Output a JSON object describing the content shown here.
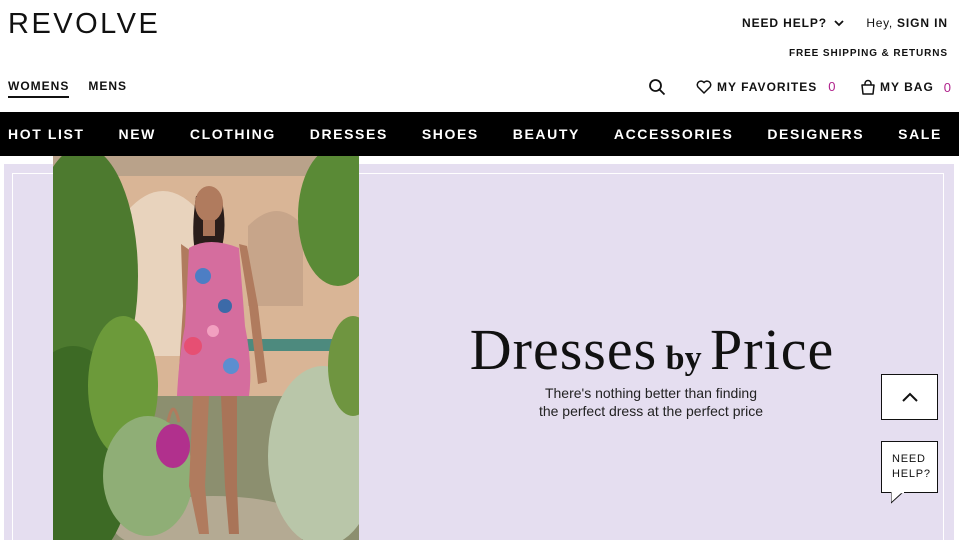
{
  "header": {
    "logo": "REVOLVE",
    "need_help": "NEED HELP?",
    "greeting": "Hey,",
    "sign_in": "SIGN IN",
    "free_shipping": "FREE SHIPPING & RETURNS"
  },
  "gender_tabs": [
    {
      "label": "WOMENS",
      "active": true
    },
    {
      "label": "MENS",
      "active": false
    }
  ],
  "utility": {
    "favorites_label": "MY FAVORITES",
    "favorites_count": "0",
    "bag_label": "MY BAG",
    "bag_count": "0"
  },
  "nav": [
    "HOT LIST",
    "NEW",
    "CLOTHING",
    "DRESSES",
    "SHOES",
    "BEAUTY",
    "ACCESSORIES",
    "DESIGNERS",
    "SALE"
  ],
  "hero": {
    "headline_part1": "Dresses",
    "headline_by": "by",
    "headline_part2": "Price",
    "subline1": "There's nothing better than finding",
    "subline2": "the perfect dress at the perfect price",
    "background": "#e5def0"
  },
  "floating": {
    "help_line1": "NEED",
    "help_line2": "HELP?"
  },
  "colors": {
    "accent": "#b0228c",
    "nav_bg": "#000000"
  }
}
